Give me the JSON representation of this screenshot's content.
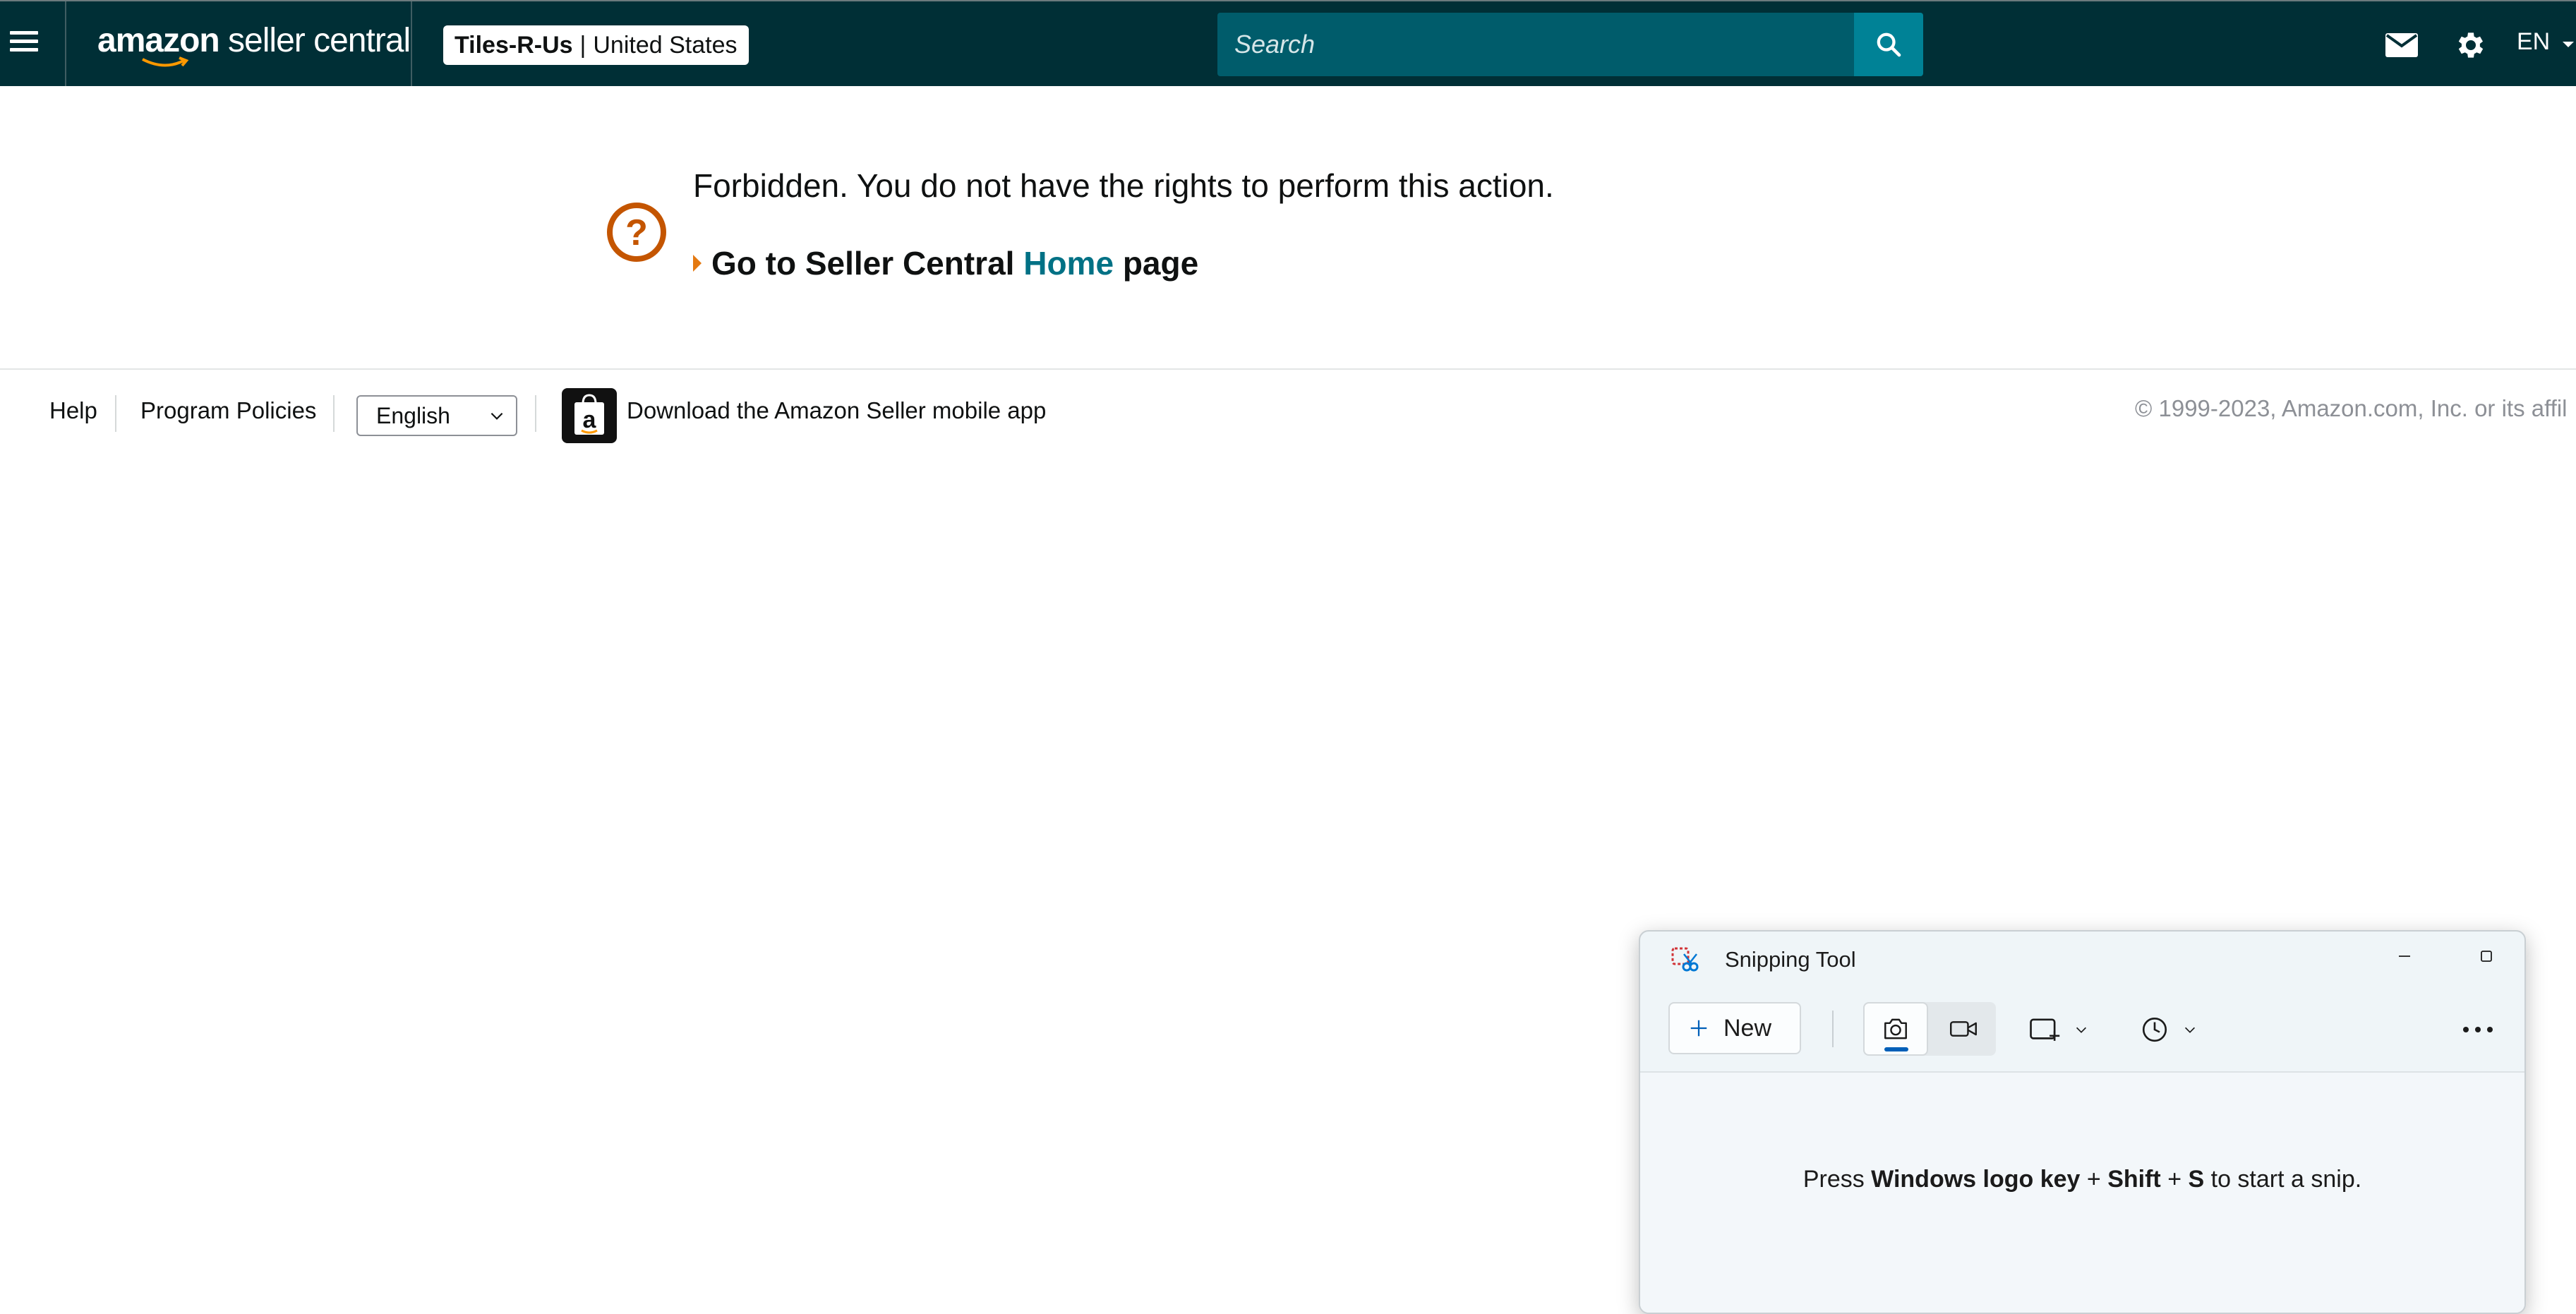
{
  "header": {
    "logo_bold": "amazon",
    "logo_rest": " seller central",
    "store_name": "Tiles-R-Us",
    "store_sep": "|",
    "store_region": "United States",
    "search_placeholder": "Search",
    "language": "EN",
    "icons": [
      "hamburger-menu-icon",
      "search-icon",
      "mail-icon",
      "gear-icon",
      "caret-down-icon"
    ]
  },
  "main": {
    "message": "Forbidden. You do not have the rights to perform this action.",
    "go_prefix": "Go to Seller Central",
    "home_link": "Home",
    "go_suffix": "page",
    "icon": "question-circle-icon"
  },
  "footer": {
    "help": "Help",
    "program_policies": "Program Policies",
    "language_selected": "English",
    "download_app": "Download the Amazon Seller mobile app",
    "copyright": "© 1999-2023, Amazon.com, Inc. or its affil"
  },
  "snipping_tool": {
    "title": "Snipping Tool",
    "new_label": "New",
    "hint_pre": "Press ",
    "hint_key1": "Windows logo key",
    "hint_plus1": " + ",
    "hint_key2": "Shift",
    "hint_plus2": " + ",
    "hint_key3": "S",
    "hint_post": " to start a snip.",
    "accent_color": "#005fb8"
  },
  "colors": {
    "topbar": "#002f36",
    "search_bg": "#005c6b",
    "search_button": "#008296",
    "link_teal": "#007185",
    "icon_orange": "#e47911",
    "question_orange": "#c45500"
  }
}
